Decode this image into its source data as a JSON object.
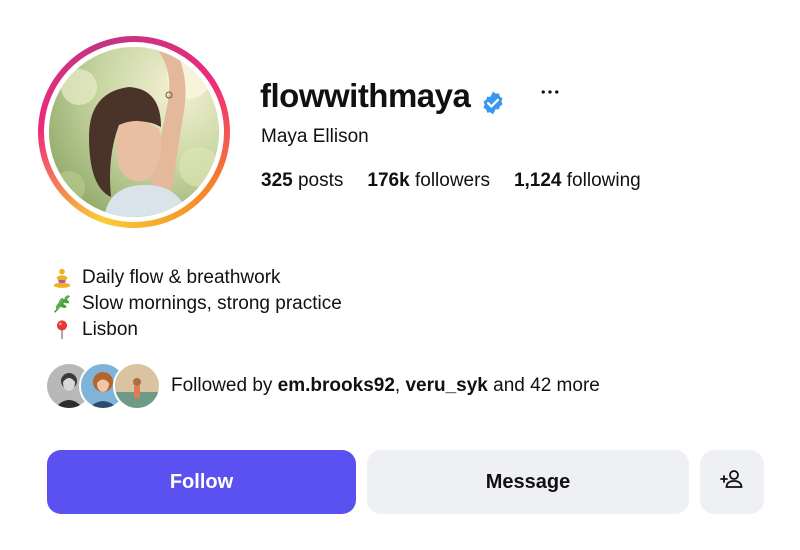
{
  "profile": {
    "username": "flowwithmaya",
    "verified": true,
    "full_name": "Maya Ellison",
    "more_icon": "more-horizontal-icon"
  },
  "stats": {
    "posts_count": "325",
    "posts_label": "posts",
    "followers_count": "176k",
    "followers_label": "followers",
    "following_count": "1,124",
    "following_label": "following"
  },
  "bio": {
    "lines": [
      {
        "icon": "meditation-emoji-icon",
        "text": "Daily flow & breathwork"
      },
      {
        "icon": "herb-emoji-icon",
        "text": "Slow mornings, strong practice"
      },
      {
        "icon": "location-pin-emoji-icon",
        "text": "Lisbon"
      }
    ]
  },
  "followed_by": {
    "prefix": "Followed by ",
    "user1": "em.brooks92",
    "separator": ", ",
    "user2": "veru_syk",
    "suffix": " and 42 more"
  },
  "actions": {
    "follow_label": "Follow",
    "message_label": "Message",
    "add_user_icon": "add-user-icon"
  },
  "colors": {
    "follow_button": "#5b51f0",
    "secondary_button": "#eff0f3",
    "verified_badge": "#3897f0"
  }
}
